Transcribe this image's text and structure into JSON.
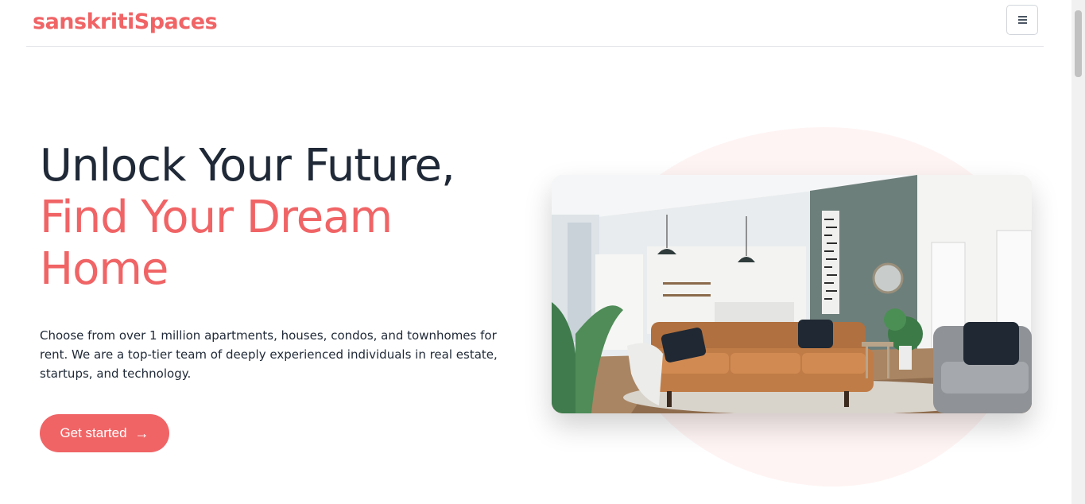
{
  "header": {
    "brand": "sanskritiSpaces",
    "menu_icon": "hamburger-icon"
  },
  "hero": {
    "title_line1": "Unlock Your Future,",
    "title_line2": "Find Your Dream",
    "title_line3": "Home",
    "description": "Choose from over 1 million apartments, houses, condos, and townhomes for rent. We are a top-tier team of deeply experienced individuals in real estate, startups, and technology.",
    "cta_label": "Get started",
    "cta_icon": "arrow-right-icon",
    "image_subject": "living-room-photo"
  },
  "colors": {
    "accent": "#f06466",
    "heading_dark": "#1f2937",
    "blob_bg": "#fff4f4"
  }
}
